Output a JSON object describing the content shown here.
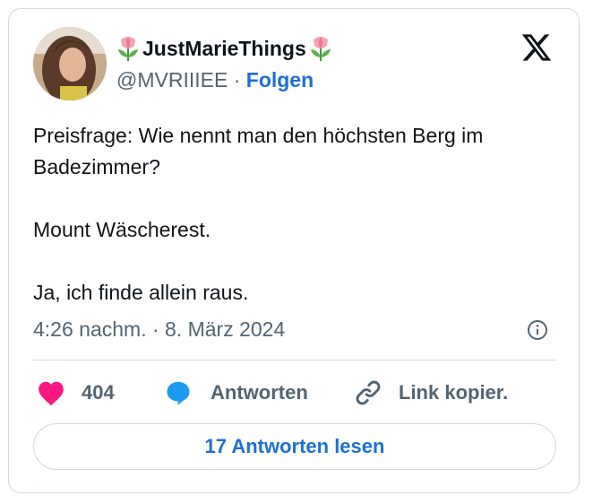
{
  "author": {
    "display_name": "JustMarieThings",
    "handle": "@MVRIIIEE",
    "separator": "·",
    "follow_label": "Folgen",
    "name_emoji_icon": "tulip-emoji-icon"
  },
  "tweet": {
    "text": "Preisfrage: Wie nennt man den höchsten Berg im Badezimmer?\n\nMount Wäscherest.\n\nJa, ich finde allein raus.",
    "timestamp": "4:26 nachm. · 8. März 2024"
  },
  "actions": {
    "like_count": "404",
    "reply_label": "Antworten",
    "copy_link_label": "Link kopier."
  },
  "read_replies_label": "17 Antworten lesen",
  "colors": {
    "link_blue": "#1d6fd6",
    "like_pink": "#f91880",
    "reply_blue": "#1d9bf0",
    "muted_gray": "#536471",
    "border": "#cfd9de"
  }
}
